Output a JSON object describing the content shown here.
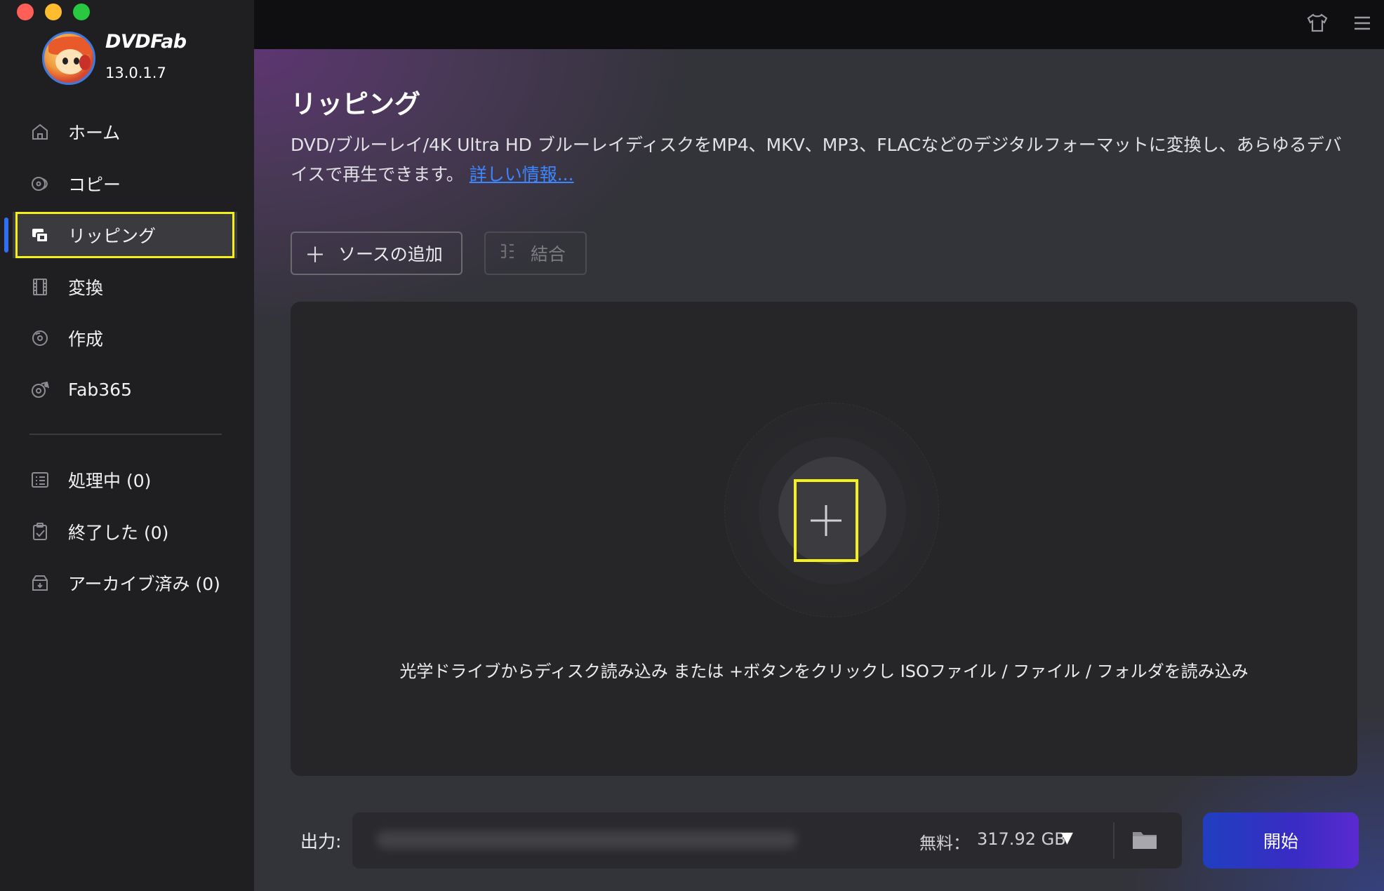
{
  "app": {
    "brand": "DVDFab",
    "version": "13.0.1.7"
  },
  "sidebar": {
    "items": [
      {
        "id": "home",
        "label": "ホーム",
        "icon": "home-icon"
      },
      {
        "id": "copy",
        "label": "コピー",
        "icon": "copy-disc-icon"
      },
      {
        "id": "ripper",
        "label": "リッピング",
        "icon": "ripper-icon",
        "active": true
      },
      {
        "id": "convert",
        "label": "変換",
        "icon": "film-icon"
      },
      {
        "id": "create",
        "label": "作成",
        "icon": "disc-create-icon"
      },
      {
        "id": "fab365",
        "label": "Fab365",
        "icon": "fab365-icon"
      }
    ],
    "queue": [
      {
        "id": "processing",
        "label": "処理中 (0)",
        "icon": "list-icon"
      },
      {
        "id": "finished",
        "label": "終了した (0)",
        "icon": "clipboard-check-icon"
      },
      {
        "id": "archived",
        "label": "アーカイブ済み (0)",
        "icon": "archive-icon"
      }
    ]
  },
  "main": {
    "title": "リッピング",
    "description": "DVD/ブルーレイ/4K Ultra HD ブルーレイディスクをMP4、MKV、MP3、FLACなどのデジタルフォーマットに変換し、あらゆるデバイスで再生できます。",
    "more_link": "詳しい情報...",
    "add_source_label": "ソースの追加",
    "merge_label": "結合",
    "drop_hint": "光学ドライブからディスク読み込み または +ボタンをクリックし ISOファイル / ファイル / フォルダを読み込み"
  },
  "bottom": {
    "output_label": "出力:",
    "free_label": "無料：",
    "free_space": "317.92 GB",
    "start_label": "開始"
  },
  "colors": {
    "accent": "#2f6ff0",
    "highlight": "#f5ef1a",
    "link": "#3e86ff",
    "start_gradient_from": "#1f3fbf",
    "start_gradient_to": "#5a2ad0"
  }
}
